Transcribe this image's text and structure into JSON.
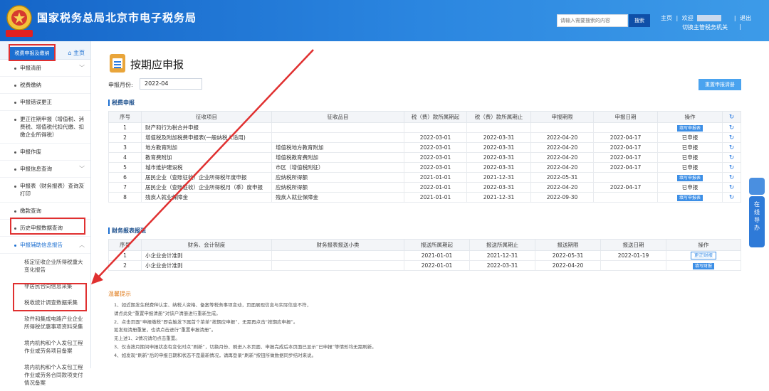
{
  "header": {
    "title": "国家税务总局北京市电子税务局",
    "search_placeholder": "请输入需要搜索的内容",
    "search_button": "搜索",
    "home": "主页",
    "welcome": "欢迎",
    "logout": "退出",
    "switch_subject": "切换主管税务机关",
    "sep": "|",
    "brand_color": "#1565c8"
  },
  "sidebar": {
    "title": "税费申报及缴纳",
    "home_label": "主页",
    "items": [
      {
        "label": "申报清册",
        "chev": "﹀"
      },
      {
        "label": "税费缴纳",
        "chev": ""
      },
      {
        "label": "申报错误更正",
        "chev": ""
      },
      {
        "label": "更正往期申报（增值税、消费税、增值税代扣代缴、扣缴企业所得税）",
        "chev": ""
      },
      {
        "label": "申报作废",
        "chev": ""
      },
      {
        "label": "申报信息查询",
        "chev": "﹀"
      },
      {
        "label": "申报表（财务报表）查询及打印",
        "chev": "﹀"
      },
      {
        "label": "缴款查询",
        "chev": ""
      },
      {
        "label": "历史申报数据查询",
        "chev": ""
      },
      {
        "label": "申报辅助信息报告",
        "chev": "︿"
      }
    ],
    "sub_items": [
      "核定征收企业所得税重大变化报告",
      "非居民合同信息采集",
      "税收统计调查数据采集",
      "软件和集成电路产业企业所得税优惠事项资料采集",
      "境内机构和个人发包工程作业或劳务项目备案",
      "境内机构和个人发包工程作业或劳务合同款项支付情况备案"
    ]
  },
  "main": {
    "title": "按期应申报",
    "period_label": "申报月份:",
    "period_value": "2022-04",
    "reset_button": "重置申报清册",
    "tax_section": "税费申报",
    "tax_headers": [
      "序号",
      "征收项目",
      "征收品目",
      "税（费）款所属期起",
      "税（费）款所属期止",
      "申报期限",
      "申报日期",
      "操作",
      "↻"
    ],
    "tax_rows": [
      {
        "no": "1",
        "item": "财产和行为税合并申报",
        "sub": "",
        "start": "",
        "end": "",
        "deadline": "",
        "date": "",
        "op": "填写申报表",
        "op_type": "button"
      },
      {
        "no": "2",
        "item": "增值税及附加税费申报表(一般纳税人适用)",
        "sub": "",
        "start": "2022-03-01",
        "end": "2022-03-31",
        "deadline": "2022-04-20",
        "date": "2022-04-17",
        "op": "已申报",
        "op_type": "text"
      },
      {
        "no": "3",
        "item": "地方教育附加",
        "sub": "增值税地方教育附加",
        "start": "2022-03-01",
        "end": "2022-03-31",
        "deadline": "2022-04-20",
        "date": "2022-04-17",
        "op": "已申报",
        "op_type": "text"
      },
      {
        "no": "4",
        "item": "教育费附加",
        "sub": "增值税教育费附加",
        "start": "2022-03-01",
        "end": "2022-03-31",
        "deadline": "2022-04-20",
        "date": "2022-04-17",
        "op": "已申报",
        "op_type": "text"
      },
      {
        "no": "5",
        "item": "城市维护建设税",
        "sub": "市区（增值税附征）",
        "start": "2022-03-01",
        "end": "2022-03-31",
        "deadline": "2022-04-20",
        "date": "2022-04-17",
        "op": "已申报",
        "op_type": "text"
      },
      {
        "no": "6",
        "item": "居民企业（查账征收）企业所得税年度申报",
        "sub": "应纳税所得额",
        "start": "2021-01-01",
        "end": "2021-12-31",
        "deadline": "2022-05-31",
        "date": "",
        "op": "填写申报表",
        "op_type": "button"
      },
      {
        "no": "7",
        "item": "居民企业（查账征收）企业所得税月（季）度申报",
        "sub": "应纳税所得额",
        "start": "2022-01-01",
        "end": "2022-03-31",
        "deadline": "2022-04-20",
        "date": "2022-04-17",
        "op": "已申报",
        "op_type": "text"
      },
      {
        "no": "8",
        "item": "残疾人就业保障金",
        "sub": "残疾人就业保障金",
        "start": "2021-01-01",
        "end": "2021-12-31",
        "deadline": "2022-09-30",
        "date": "",
        "op": "填写申报表",
        "op_type": "button"
      }
    ],
    "fin_section": "财务报表报送",
    "fin_headers": [
      "序号",
      "财务、会计制度",
      "财务报表报送小类",
      "报送所属期起",
      "报送所属期止",
      "报送期限",
      "报送日期",
      "操作"
    ],
    "fin_rows": [
      {
        "no": "1",
        "system": "小企业会计准则",
        "sub": "",
        "start": "2021-01-01",
        "end": "2021-12-31",
        "deadline": "2022-05-31",
        "date": "2022-01-19",
        "op": "更正财报",
        "op_type": "outline"
      },
      {
        "no": "2",
        "system": "小企业会计准则",
        "sub": "",
        "start": "2022-01-01",
        "end": "2022-03-31",
        "deadline": "2022-04-20",
        "date": "",
        "op": "填写财报",
        "op_type": "button"
      }
    ],
    "tips_title": "温馨提示",
    "tips": [
      "1、如近期发生税费种认定、纳税人资格、备案等税务事项变动，页面展现信息与实际信息不符，",
      "请点此处“重置申报清册”对该户清册进行重新生成。",
      "2、点击页面“申报缴税”即会触发下属首个菜单“按期应申报”，无需再点击“按期应申报”。",
      "如发现清册重复，也请点击进行“重置申报清册”。",
      "无上述1、2情况请勿点击重置。",
      "3、仅当按月期间申报状态有变化时点“刷新”，切换月份、刷进入本页面、申报完成后本页面已显示“已申报”等情形均无需刷新。",
      "4、如发现“刷新”后的申报日期和状态不是最新情况，请再登录“刷新”按钮所做数据同步结时来说。"
    ]
  },
  "float": {
    "text": "在线导办"
  }
}
